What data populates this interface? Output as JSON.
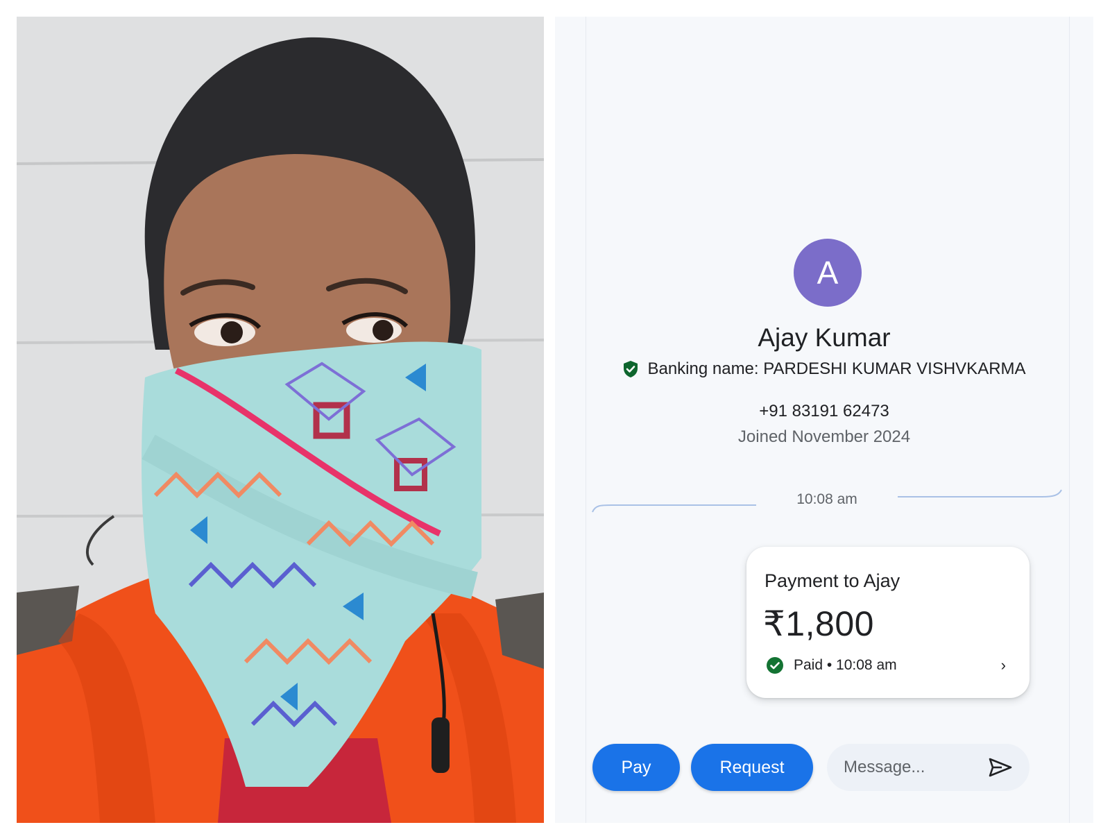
{
  "photo": {
    "description_icon": "person-photo"
  },
  "profile": {
    "avatar_letter": "A",
    "name": "Ajay Kumar",
    "banking_name": "Banking name: PARDESHI KUMAR VISHVKARMA",
    "phone": "+91 83191 62473",
    "joined": "Joined November 2024"
  },
  "chat": {
    "timestamp": "10:08 am"
  },
  "payment": {
    "title": "Payment to Ajay",
    "amount": "₹1,800",
    "status": "Paid • 10:08 am",
    "chevron": "›"
  },
  "actions": {
    "pay_label": "Pay",
    "request_label": "Request",
    "message_placeholder": "Message..."
  },
  "colors": {
    "accent": "#1a73e8",
    "avatar": "#7b6dc9",
    "success": "#137333",
    "shield": "#0d652d"
  }
}
